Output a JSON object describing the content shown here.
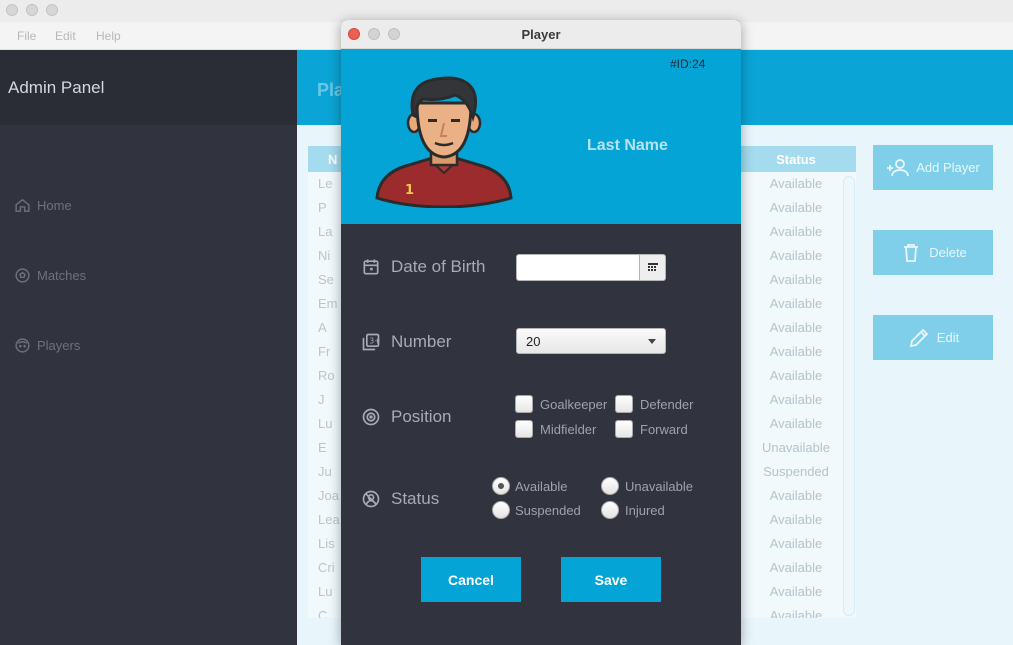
{
  "menu": {
    "file": "File",
    "edit": "Edit",
    "help": "Help"
  },
  "sidebar": {
    "title": "Admin Panel",
    "items": [
      {
        "label": "Home",
        "icon": "home-icon"
      },
      {
        "label": "Matches",
        "icon": "soccer-ball-icon"
      },
      {
        "label": "Players",
        "icon": "player-face-icon"
      }
    ]
  },
  "content": {
    "header_title_partial": "Pla",
    "table": {
      "col_name_partial": "N",
      "col_status": "Status",
      "rows": [
        {
          "name": "Le",
          "status": "Available"
        },
        {
          "name": "P",
          "status": "Available"
        },
        {
          "name": "La",
          "status": "Available"
        },
        {
          "name": "Ni",
          "status": "Available"
        },
        {
          "name": "Se",
          "status": "Available"
        },
        {
          "name": "Em",
          "status": "Available"
        },
        {
          "name": "A",
          "status": "Available"
        },
        {
          "name": "Fr",
          "status": "Available"
        },
        {
          "name": "Ro",
          "status": "Available"
        },
        {
          "name": "J",
          "status": "Available"
        },
        {
          "name": "Lu",
          "status": "Available"
        },
        {
          "name": "E",
          "status": "Unavailable"
        },
        {
          "name": "Ju",
          "status": "Suspended"
        },
        {
          "name": "Joa",
          "status": "Available"
        },
        {
          "name": "Lea",
          "status": "Available"
        },
        {
          "name": "Lis",
          "status": "Available"
        },
        {
          "name": "Cri",
          "status": "Available"
        },
        {
          "name": "Lu",
          "status": "Available"
        },
        {
          "name": "C",
          "status": "Available"
        }
      ]
    },
    "buttons": {
      "add_player": "Add Player",
      "delete": "Delete",
      "edit": "Edit"
    }
  },
  "dialog": {
    "title": "Player",
    "id_label": "#ID:24",
    "last_name": "Last Name",
    "date_of_birth_label": "Date of Birth",
    "date_of_birth_value": "",
    "number_label": "Number",
    "number_value": "20",
    "position_label": "Position",
    "positions": [
      "Goalkeeper",
      "Defender",
      "Midfielder",
      "Forward"
    ],
    "status_label": "Status",
    "statuses": [
      "Available",
      "Unavailable",
      "Suspended",
      "Injured"
    ],
    "selected_status": "Available",
    "cancel_label": "Cancel",
    "save_label": "Save"
  },
  "colors": {
    "accent": "#04a4d6",
    "sidebar_bg": "#31343f",
    "close_dot": "#ec5f57"
  }
}
